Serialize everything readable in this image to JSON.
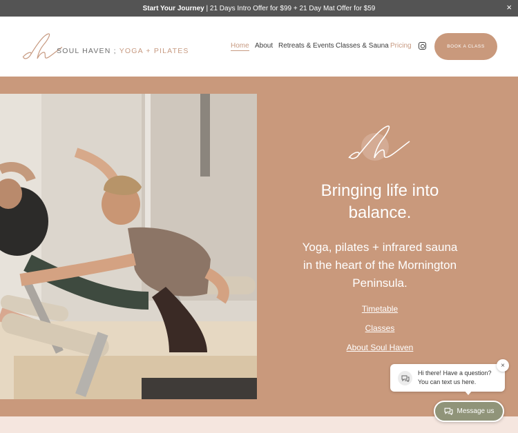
{
  "announcement": {
    "bold": "Start Your Journey",
    "rest": " | 21 Days Intro Offer for $99 + 21 Day Mat  Offer for $59",
    "close": "×"
  },
  "logo": {
    "monogram": "sh",
    "name": "SOUL HAVEN ; ",
    "accent": "YOGA + PILATES"
  },
  "nav": {
    "home": "Home",
    "about": "About",
    "retreats": "Retreats & Events",
    "classes": "Classes & Sauna",
    "pricing": "Pricing",
    "book": "BOOK A CLASS"
  },
  "hero": {
    "tagline": "Bringing life into balance.",
    "subline": "Yoga, pilates + infrared sauna in the heart of the Mornington Peninsula.",
    "links": [
      "Timetable",
      "Classes",
      "About Soul Haven"
    ]
  },
  "chat": {
    "message": "Hi there! Have a question? You can text us here.",
    "close": "×",
    "button": "Message us"
  },
  "colors": {
    "accent": "#c9997c",
    "announce_bg": "#545454",
    "chat_button": "#909479"
  }
}
